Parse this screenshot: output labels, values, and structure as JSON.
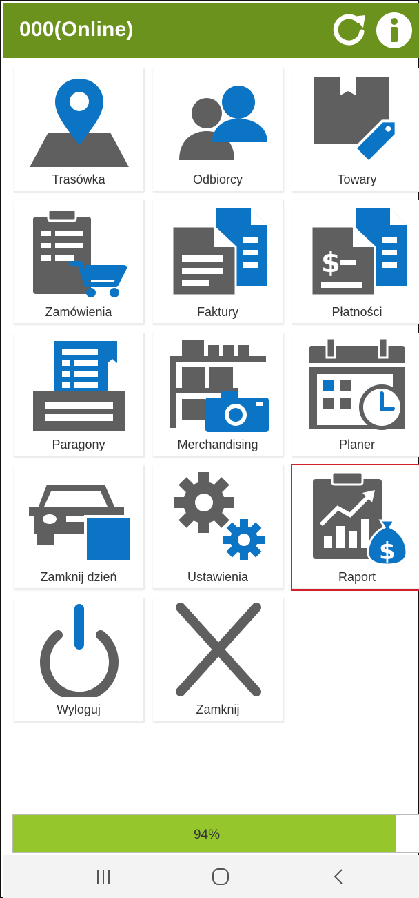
{
  "header": {
    "title": "000(Online)",
    "refresh_icon": "refresh-icon",
    "info_icon": "info-icon",
    "color": "#6a921d"
  },
  "tiles": [
    {
      "label": "Trasówka",
      "icon": "map-pin-icon"
    },
    {
      "label": "Odbiorcy",
      "icon": "users-icon"
    },
    {
      "label": "Towary",
      "icon": "box-tag-icon"
    },
    {
      "label": "Zamówienia",
      "icon": "clipboard-cart-icon"
    },
    {
      "label": "Faktury",
      "icon": "documents-icon"
    },
    {
      "label": "Płatności",
      "icon": "dollar-documents-icon"
    },
    {
      "label": "Paragony",
      "icon": "receipt-printer-icon"
    },
    {
      "label": "Merchandising",
      "icon": "shelf-camera-icon"
    },
    {
      "label": "Planer",
      "icon": "calendar-clock-icon"
    },
    {
      "label": "Zamknij dzień",
      "icon": "car-icon"
    },
    {
      "label": "Ustawienia",
      "icon": "gears-icon"
    },
    {
      "label": "Raport",
      "icon": "report-money-icon",
      "selected": true
    },
    {
      "label": "Wyloguj",
      "icon": "power-icon"
    },
    {
      "label": "Zamknij",
      "icon": "close-x-icon"
    }
  ],
  "progress": {
    "text": "94%",
    "value": 0.94
  },
  "colors": {
    "icon_gray": "#5f5f5f",
    "icon_blue": "#0b74c4",
    "progress": "#95c72d",
    "selected_border": "#d4202a"
  },
  "navbar": {
    "recent_icon": "recent-apps-icon",
    "home_icon": "home-icon",
    "back_icon": "back-icon"
  }
}
